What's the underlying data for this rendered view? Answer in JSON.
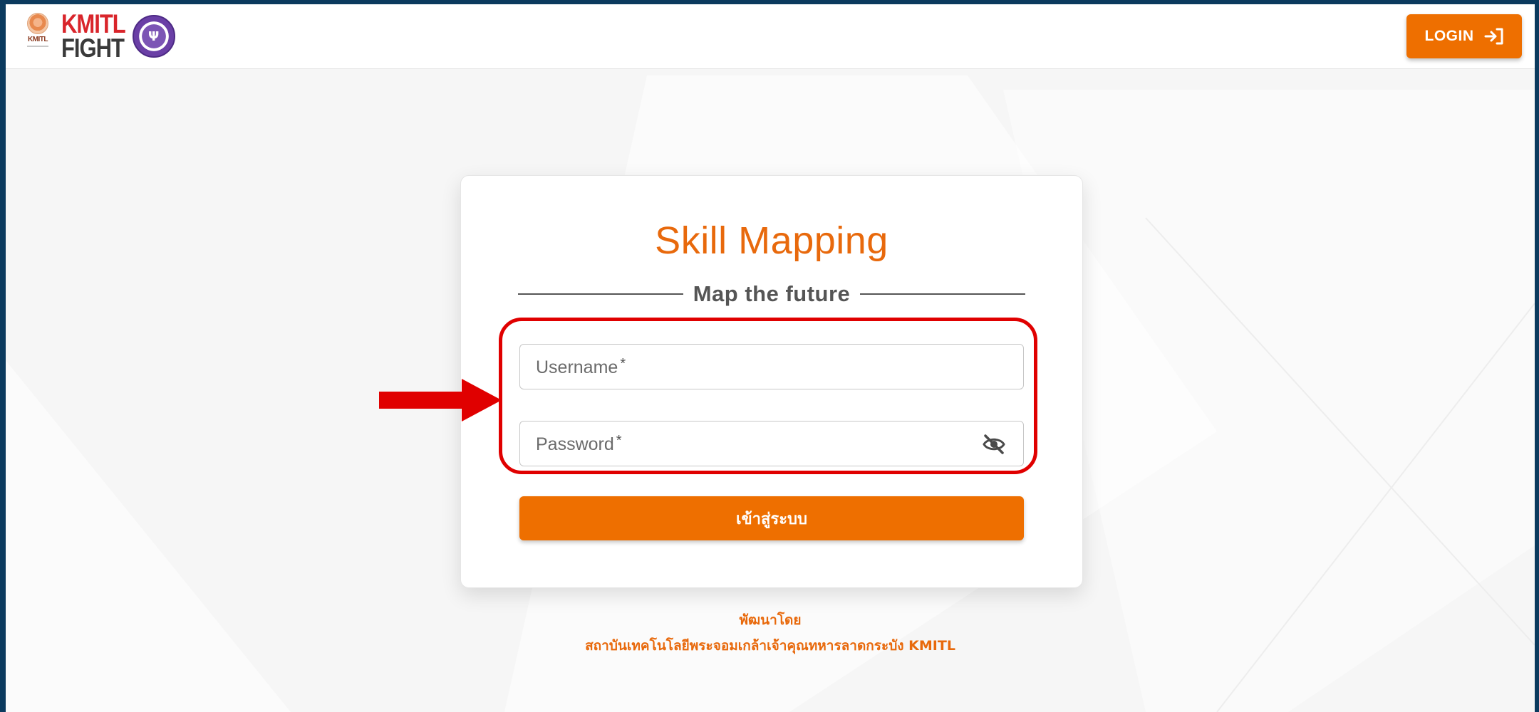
{
  "header": {
    "logo_kmitl_seal_text": "KMITL",
    "logo_fight_top": "KMITL",
    "logo_fight_bottom": "FIGHT",
    "login_button_label": "LOGIN",
    "login_icon": "login-arrow-icon"
  },
  "card": {
    "title": "Skill Mapping",
    "tagline": "Map the future",
    "username": {
      "label": "Username",
      "required_mark": "*",
      "value": ""
    },
    "password": {
      "label": "Password",
      "required_mark": "*",
      "value": "",
      "toggle_icon": "eye-slash-icon"
    },
    "submit_label": "เข้าสู่ระบบ"
  },
  "credits": {
    "line1": "พัฒนาโดย",
    "line2": "สถาบันเทคโนโลยีพระจอมเกล้าเจ้าคุณทหารลาดกระบัง KMITL"
  },
  "annotation": {
    "highlight_color": "#e00000",
    "arrow_color": "#e00000"
  },
  "colors": {
    "accent": "#ee6f00",
    "title": "#e8690c",
    "frame": "#0b3a5e"
  }
}
